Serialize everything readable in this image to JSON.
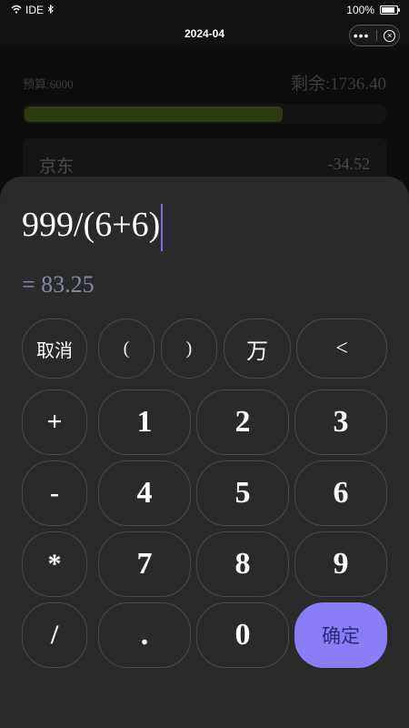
{
  "status_bar": {
    "carrier": "IDE",
    "battery": "100%",
    "battery_level": 1.0
  },
  "nav": {
    "title": "2024-04",
    "more_glyph": "•••",
    "close_glyph": "×"
  },
  "background": {
    "budget_label": "预算:6000",
    "remaining_label": "剩余:1736.40",
    "progress_fraction": 0.71,
    "progress_color": "#2d3b13",
    "card": {
      "name": "京东",
      "amount": "-34.52"
    }
  },
  "calculator": {
    "expression": "999/(6+6)",
    "result": "= 83.25",
    "accent": "#8a7df5",
    "keys": {
      "cancel": "取消",
      "lparen": "(",
      "rparen": ")",
      "wan": "万",
      "backspace": "<",
      "plus": "+",
      "minus": "-",
      "multiply": "*",
      "divide": "/",
      "d1": "1",
      "d2": "2",
      "d3": "3",
      "d4": "4",
      "d5": "5",
      "d6": "6",
      "d7": "7",
      "d8": "8",
      "d9": "9",
      "dot": ".",
      "d0": "0",
      "confirm": "确定"
    }
  }
}
